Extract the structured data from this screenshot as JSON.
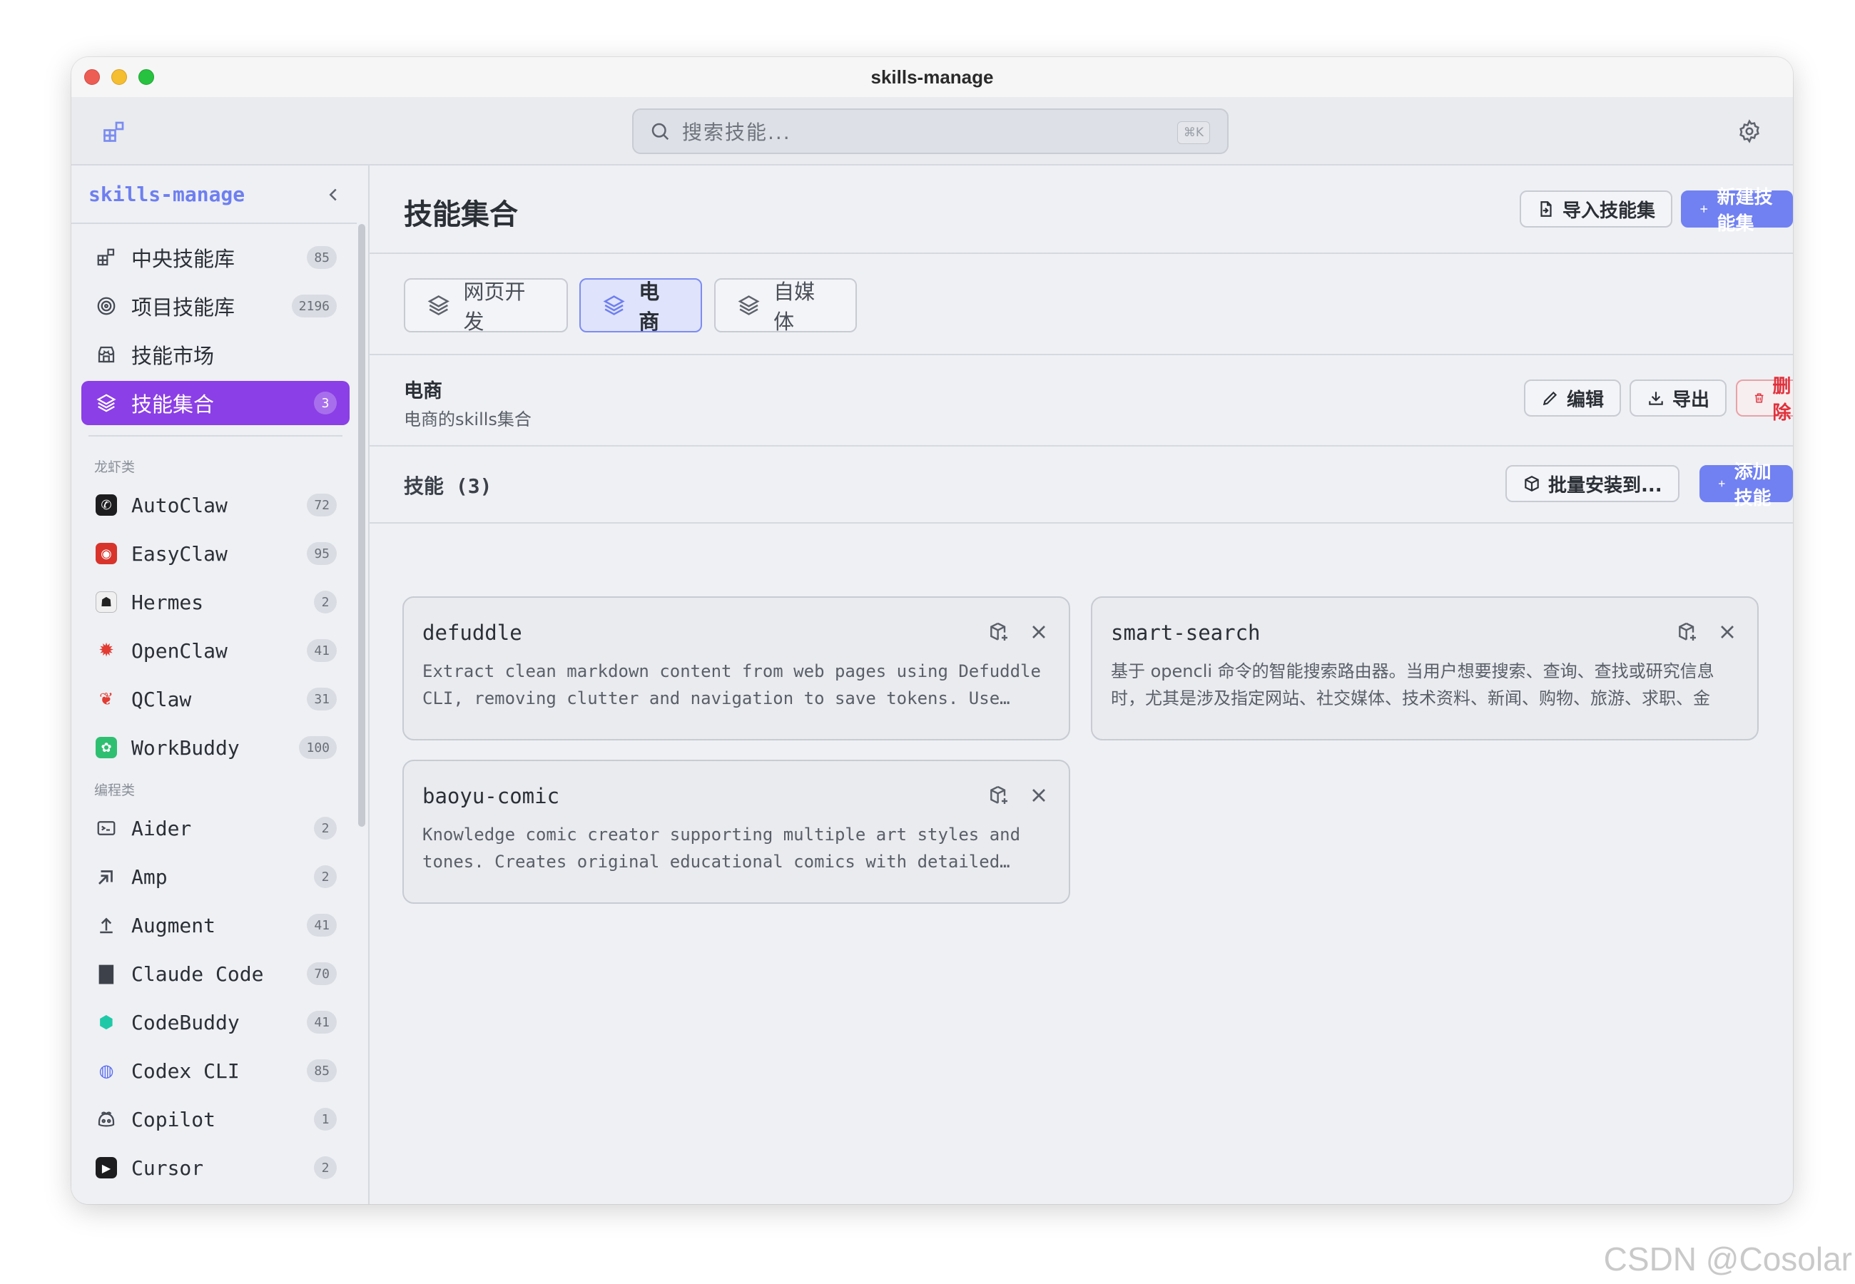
{
  "window": {
    "title": "skills-manage"
  },
  "toolbar": {
    "search_placeholder": "搜索技能...",
    "shortcut": "⌘K"
  },
  "sidebar": {
    "brand": "skills-manage",
    "main_items": [
      {
        "label": "中央技能库",
        "count": "85"
      },
      {
        "label": "项目技能库",
        "count": "2196"
      },
      {
        "label": "技能市场",
        "count": ""
      },
      {
        "label": "技能集合",
        "count": "3"
      }
    ],
    "groups": [
      {
        "label": "龙虾类",
        "items": [
          {
            "label": "AutoClaw",
            "count": "72"
          },
          {
            "label": "EasyClaw",
            "count": "95"
          },
          {
            "label": "Hermes",
            "count": "2"
          },
          {
            "label": "OpenClaw",
            "count": "41"
          },
          {
            "label": "QClaw",
            "count": "31"
          },
          {
            "label": "WorkBuddy",
            "count": "100"
          }
        ]
      },
      {
        "label": "编程类",
        "items": [
          {
            "label": "Aider",
            "count": "2"
          },
          {
            "label": "Amp",
            "count": "2"
          },
          {
            "label": "Augment",
            "count": "41"
          },
          {
            "label": "Claude Code",
            "count": "70"
          },
          {
            "label": "CodeBuddy",
            "count": "41"
          },
          {
            "label": "Codex CLI",
            "count": "85"
          },
          {
            "label": "Copilot",
            "count": "1"
          },
          {
            "label": "Cursor",
            "count": "2"
          }
        ]
      }
    ]
  },
  "main": {
    "title": "技能集合",
    "import_label": "导入技能集",
    "new_label": "新建技能集",
    "tabs": [
      {
        "label": "网页开发"
      },
      {
        "label": "电商"
      },
      {
        "label": "自媒体"
      }
    ],
    "set": {
      "name": "电商",
      "description": "电商的skills集合",
      "edit_label": "编辑",
      "export_label": "导出",
      "delete_label": "删除"
    },
    "skills_header": "技能 (3)",
    "batch_install_label": "批量安装到...",
    "add_skill_label": "添加技能",
    "skills": [
      {
        "name": "defuddle",
        "description": "Extract clean markdown content from web pages using Defuddle CLI, removing clutter and navigation to save tokens. Use…"
      },
      {
        "name": "smart-search",
        "description": "基于 opencli 命令的智能搜索路由器。当用户想要搜索、查询、查找或研究信息时，尤其是涉及指定网站、社交媒体、技术资料、新闻、购物、旅游、求职、金融…"
      },
      {
        "name": "baoyu-comic",
        "description": "Knowledge comic creator supporting multiple art styles and tones. Creates original educational comics with detailed…"
      }
    ]
  },
  "watermark": "CSDN @Cosolar",
  "colors": {
    "accent": "#7181f2",
    "active_nav": "#8b3fe6",
    "danger": "#e0313c"
  }
}
